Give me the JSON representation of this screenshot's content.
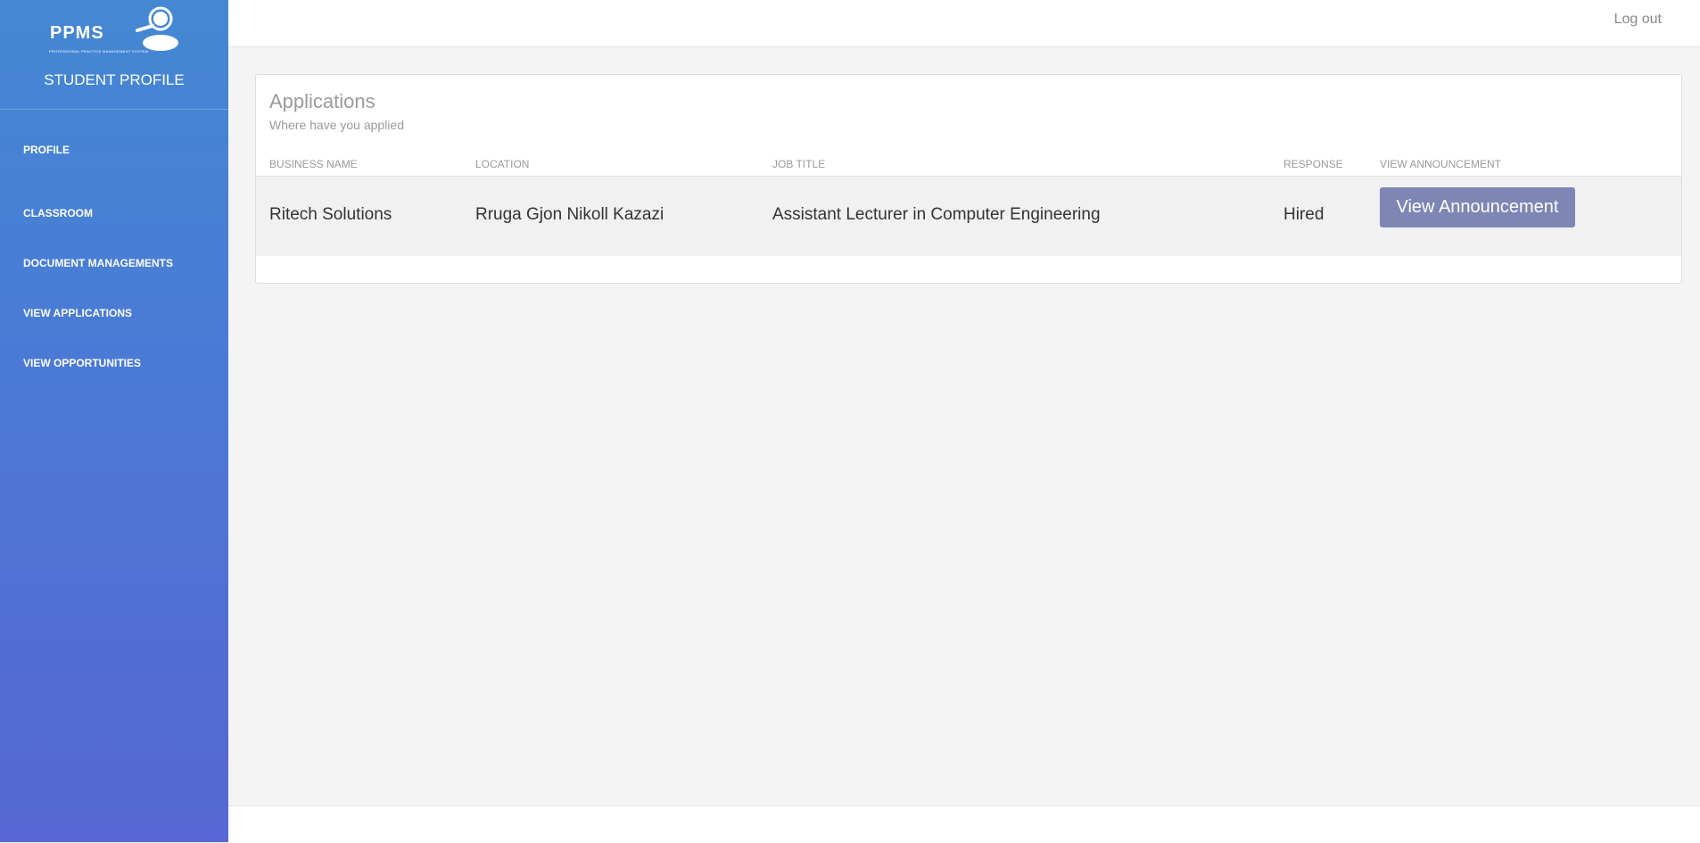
{
  "sidebar": {
    "logo_text": "PPMS",
    "logo_subtext": "PROFESSIONAL PRACTICE MANAGEMENT SYSTEM",
    "title": "STUDENT PROFILE",
    "items": [
      {
        "label": "PROFILE"
      },
      {
        "label": "CLASSROOM"
      },
      {
        "label": "DOCUMENT MANAGEMENTS"
      },
      {
        "label": "VIEW APPLICATIONS"
      },
      {
        "label": "VIEW OPPORTUNITIES"
      }
    ]
  },
  "header": {
    "logout_label": "Log out"
  },
  "card": {
    "title": "Applications",
    "subtitle": "Where have you applied",
    "columns": [
      "BUSINESS NAME",
      "LOCATION",
      "JOB TITLE",
      "RESPONSE",
      "VIEW ANNOUNCEMENT"
    ],
    "rows": [
      {
        "business_name": "Ritech Solutions",
        "location": "Rruga Gjon Nikoll Kazazi",
        "job_title": "Assistant Lecturer in Computer Engineering",
        "response": "Hired",
        "button_label": "View Announcement"
      }
    ]
  },
  "colors": {
    "sidebar_top": "#4488d2",
    "sidebar_bottom": "#5766d4",
    "button": "#7d86b4"
  }
}
